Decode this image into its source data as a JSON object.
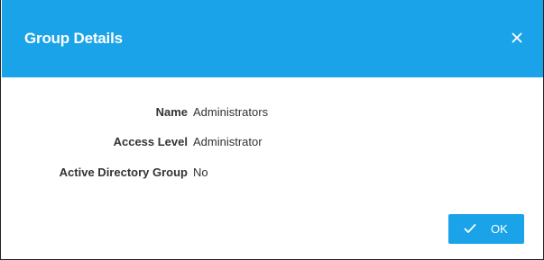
{
  "dialog": {
    "title": "Group Details",
    "close_icon": "close-icon"
  },
  "details": [
    {
      "label": "Name",
      "value": "Administrators"
    },
    {
      "label": "Access Level",
      "value": "Administrator"
    },
    {
      "label": "Active Directory Group",
      "value": "No"
    }
  ],
  "footer": {
    "ok_label": "OK",
    "ok_icon": "check-icon"
  },
  "colors": {
    "header": "#1aa3e8",
    "button": "#1aa3e8",
    "text": "#333333"
  }
}
